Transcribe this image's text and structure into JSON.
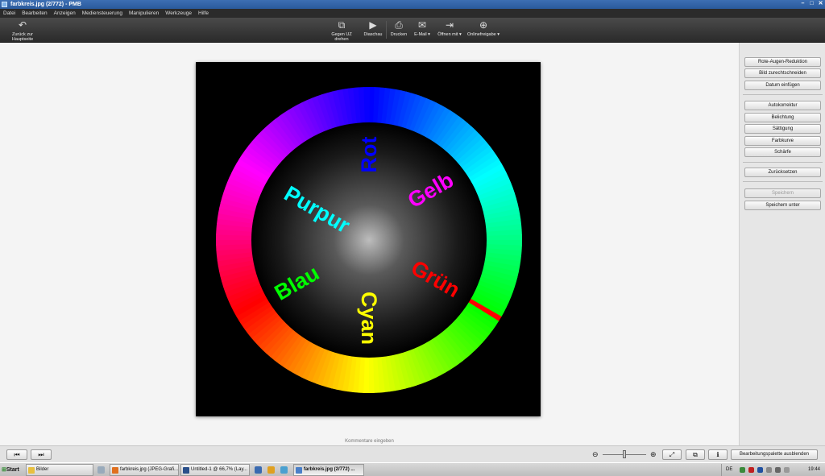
{
  "window": {
    "title": "farbkreis.jpg (2/772) - PMB"
  },
  "menu": [
    "Datei",
    "Bearbeiten",
    "Anzeigen",
    "Mediensteuerung",
    "Manipulieren",
    "Werkzeuge",
    "Hilfe"
  ],
  "toolbar": {
    "back": "Zurück zur Hauptseite",
    "rotate": "Gegen UZ drehen",
    "slideshow": "Diaschau",
    "print": "Drucken",
    "email": "E-Mail ▾",
    "open_with": "Öffnen mit ▾",
    "online": "Onlinefreigabe ▾"
  },
  "image": {
    "labels": [
      "Rot",
      "Gelb",
      "Grün",
      "Cyan",
      "Blau",
      "Purpur"
    ],
    "colors": {
      "rot": "#0000ff",
      "gelb": "#ff00ff",
      "gruen": "#ff0000",
      "cyan": "#ffff00",
      "blau": "#00ff00",
      "purpur": "#00ffff"
    }
  },
  "comment_placeholder": "Kommentare eingeben",
  "panel": {
    "redeye": "Rote-Augen-Reduktion",
    "crop": "Bild zurechtschneiden",
    "date": "Datum einfügen",
    "auto": "Autokorrektur",
    "exposure": "Belichtung",
    "saturation": "Sättigung",
    "curve": "Farbkurve",
    "sharpen": "Schärfe",
    "reset": "Zurücksetzen",
    "save": "Speichern",
    "save_as": "Speichern unter"
  },
  "bottom": {
    "toggle_palette": "Bearbeitungspalette ausblenden"
  },
  "taskbar": {
    "start": "Start",
    "items": [
      "Bilder",
      "farbkreis.jpg (JPEG-Grafi...",
      "Untitled-1 @ 66,7% (Lay...",
      "farbkreis.jpg (2/772) ..."
    ],
    "lang": "DE",
    "clock": "19:44"
  }
}
